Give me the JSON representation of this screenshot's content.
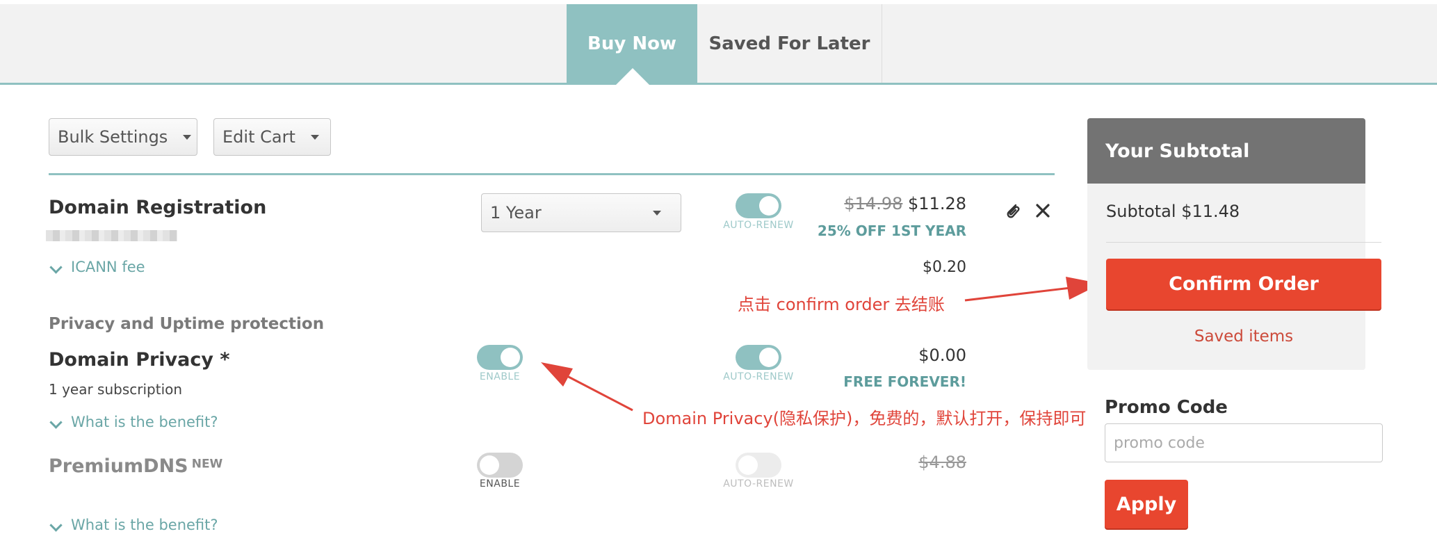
{
  "tabs": {
    "buy_now": "Buy Now",
    "saved_for_later": "Saved For Later"
  },
  "toolbar": {
    "bulk_settings": "Bulk Settings",
    "edit_cart": "Edit Cart"
  },
  "domain_registration": {
    "title": "Domain Registration",
    "duration": "1 Year",
    "auto_renew_label": "AUTO-RENEW",
    "old_price": "$14.98",
    "price": "$11.28",
    "discount": "25% OFF 1ST YEAR",
    "icann_label": "ICANN fee",
    "icann_price": "$0.20"
  },
  "privacy_section": {
    "heading": "Privacy and Uptime protection"
  },
  "domain_privacy": {
    "title": "Domain Privacy *",
    "subtitle": "1 year subscription",
    "enable_label": "ENABLE",
    "auto_renew_label": "AUTO-RENEW",
    "price": "$0.00",
    "note": "FREE FOREVER!",
    "benefit_link": "What is the benefit?"
  },
  "premium_dns": {
    "title": "PremiumDNS",
    "badge": "NEW",
    "enable_label": "ENABLE",
    "auto_renew_label": "AUTO-RENEW",
    "old_price": "$4.88",
    "benefit_link": "What is the benefit?"
  },
  "subtotal_panel": {
    "header": "Your Subtotal",
    "subtotal_label": "Subtotal $11.48",
    "confirm_button": "Confirm Order",
    "saved_items": "Saved items"
  },
  "promo": {
    "heading": "Promo Code",
    "placeholder": "promo code",
    "apply_button": "Apply"
  },
  "annotations": {
    "confirm_note": "点击 confirm order 去结账",
    "privacy_note": "Domain Privacy(隐私保护)，免费的，默认打开，保持即可"
  },
  "colors": {
    "teal": "#8fc1c1",
    "accent_red": "#e8462f",
    "panel_header": "#737373",
    "annotation_red": "#e0443a"
  }
}
